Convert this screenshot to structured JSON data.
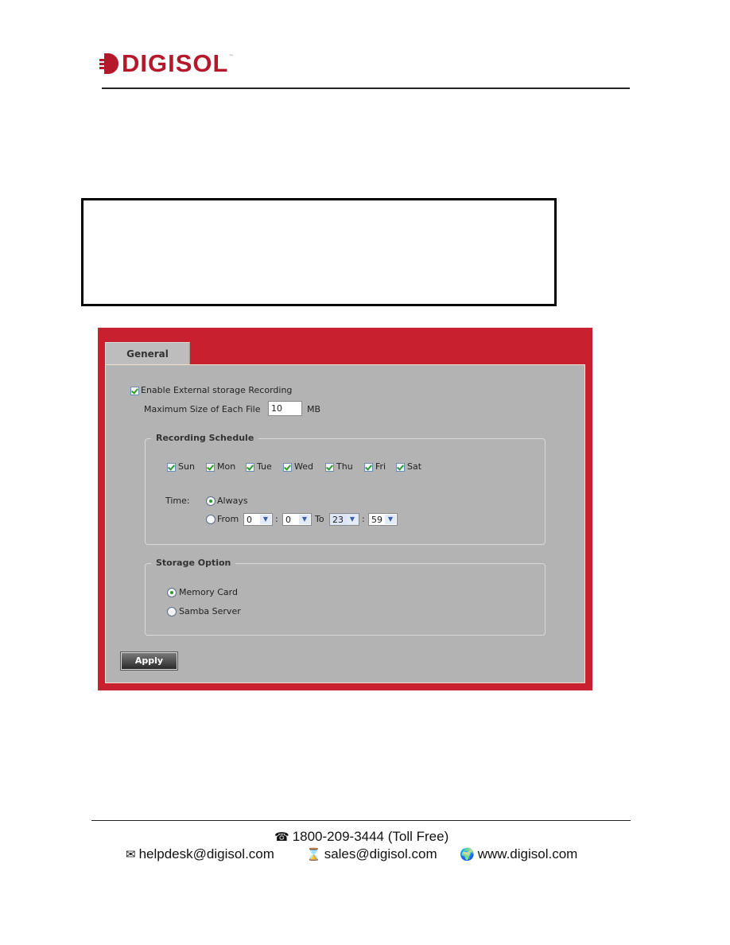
{
  "header": {
    "brand": "DIGISOL",
    "trademark": "™"
  },
  "panel": {
    "tab_label": "General",
    "enable_recording": {
      "label": "Enable External storage Recording",
      "checked": true
    },
    "max_file_size": {
      "label": "Maximum Size of Each File",
      "value": "10",
      "unit": "MB"
    },
    "recording_schedule": {
      "legend": "Recording Schedule",
      "days": [
        {
          "label": "Sun",
          "checked": true
        },
        {
          "label": "Mon",
          "checked": true
        },
        {
          "label": "Tue",
          "checked": true
        },
        {
          "label": "Wed",
          "checked": true
        },
        {
          "label": "Thu",
          "checked": true
        },
        {
          "label": "Fri",
          "checked": true
        },
        {
          "label": "Sat",
          "checked": true
        }
      ],
      "time_label": "Time:",
      "always_label": "Always",
      "always_selected": true,
      "from_label": "From",
      "to_label": "To",
      "separator": ":",
      "from_hour": "0",
      "from_minute": "0",
      "to_hour": "23",
      "to_minute": "59",
      "dropdown_arrow": "▼"
    },
    "storage_option": {
      "legend": "Storage Option",
      "options": [
        {
          "label": "Memory Card",
          "selected": true
        },
        {
          "label": "Samba Server",
          "selected": false
        }
      ]
    },
    "apply_label": "Apply"
  },
  "footer": {
    "phone": "1800-209-3444 (Toll Free)",
    "helpdesk_email": "helpdesk@digisol.com",
    "sales_email": "sales@digisol.com",
    "website": "www.digisol.com",
    "icons": {
      "phone": "☎",
      "mail": "✉",
      "hourglass": "⌛",
      "globe": "🌍"
    }
  },
  "colors": {
    "brand_red": "#b5182a",
    "panel_red": "#c8202e",
    "panel_gray": "#b3b3b3",
    "check_green": "#2e9a2e"
  }
}
